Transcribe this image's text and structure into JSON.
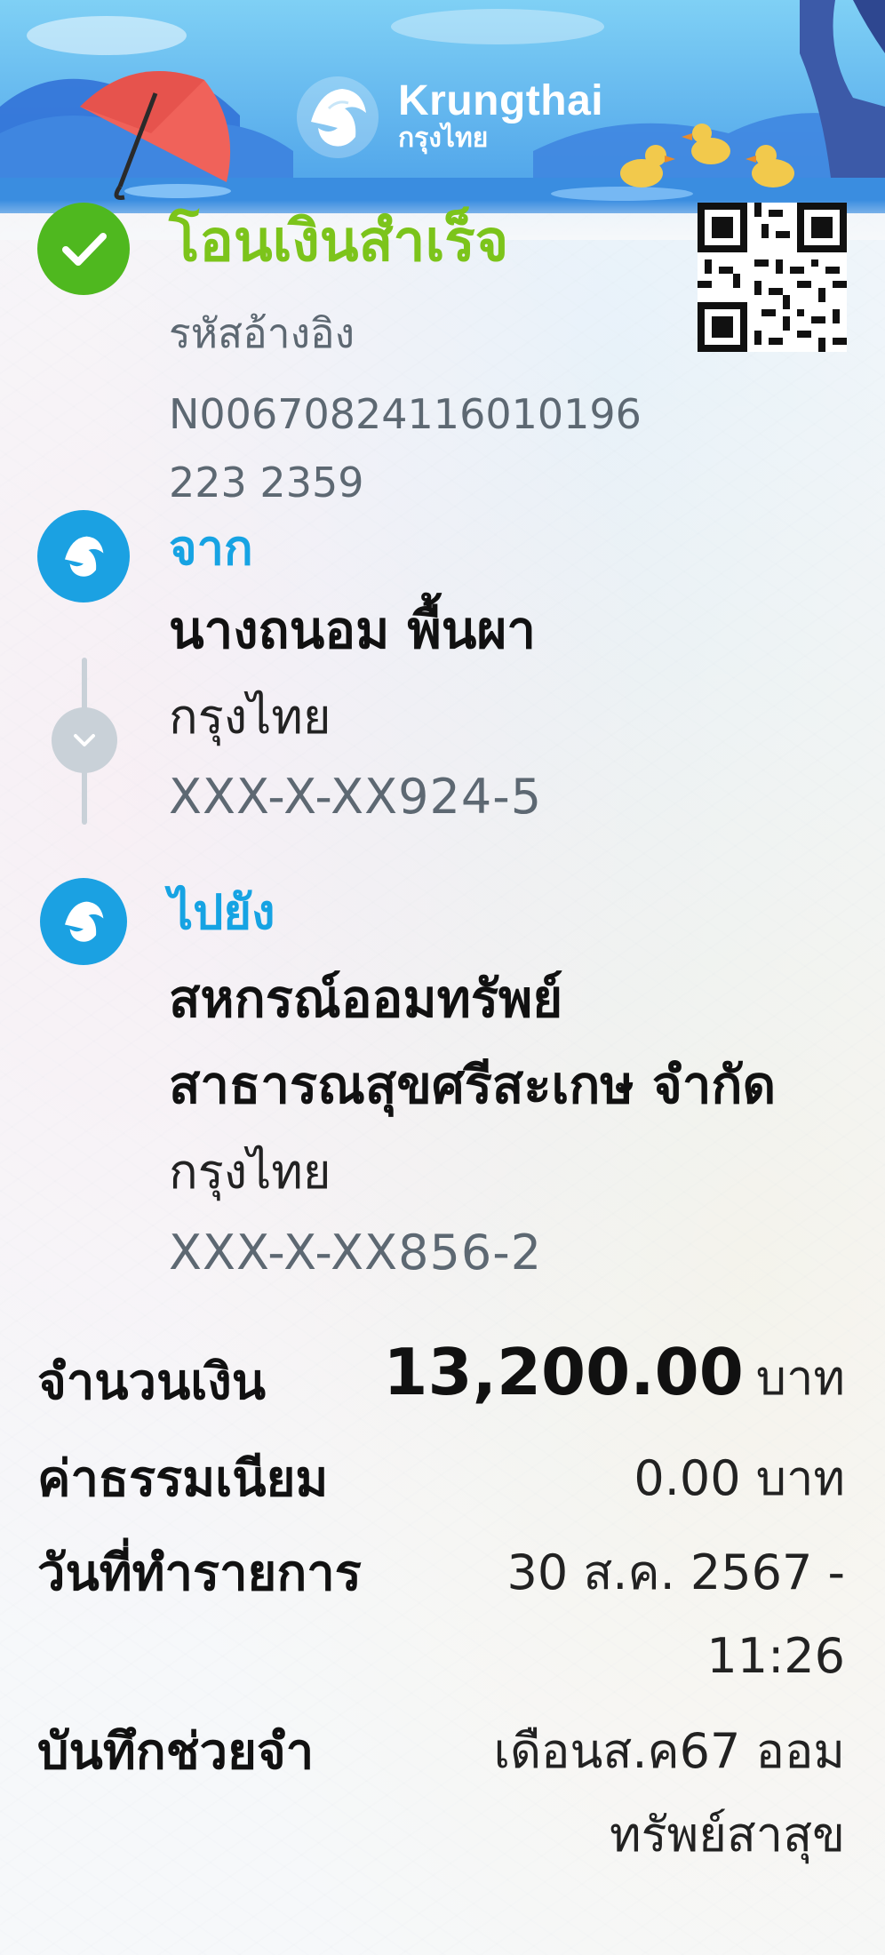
{
  "brand": {
    "name": "Krungthai",
    "name_thai": "กรุงไทย"
  },
  "status": {
    "title": "โอนเงินสำเร็จ",
    "ref_label": "รหัสอ้างอิง",
    "ref_number": "N00670824116010196223 2359"
  },
  "from": {
    "label": "จาก",
    "name": "นางถนอม พื้นผา",
    "bank": "กรุงไทย",
    "account": "XXX-X-XX924-5"
  },
  "to": {
    "label": "ไปยัง",
    "name_line1": "สหกรณ์ออมทรัพย์",
    "name_line2": "สาธารณสุขศรีสะเกษ จำกัด",
    "bank": "กรุงไทย",
    "account": "XXX-X-XX856-2"
  },
  "details": {
    "amount_label": "จำนวนเงิน",
    "amount_value": "13,200.00",
    "amount_unit": "บาท",
    "fee_label": "ค่าธรรมเนียม",
    "fee_value": "0.00 บาท",
    "date_label": "วันที่ทำรายการ",
    "date_line1": "30 ส.ค. 2567 -",
    "date_line2": "11:26",
    "memo_label": "บันทึกช่วยจำ",
    "memo_line1": "เดือนส.ค67 ออม",
    "memo_line2": "ทรัพย์สาสุข"
  },
  "colors": {
    "success": "#4fb81f",
    "success_text": "#7cc41b",
    "brand_blue": "#1ba1e2"
  }
}
